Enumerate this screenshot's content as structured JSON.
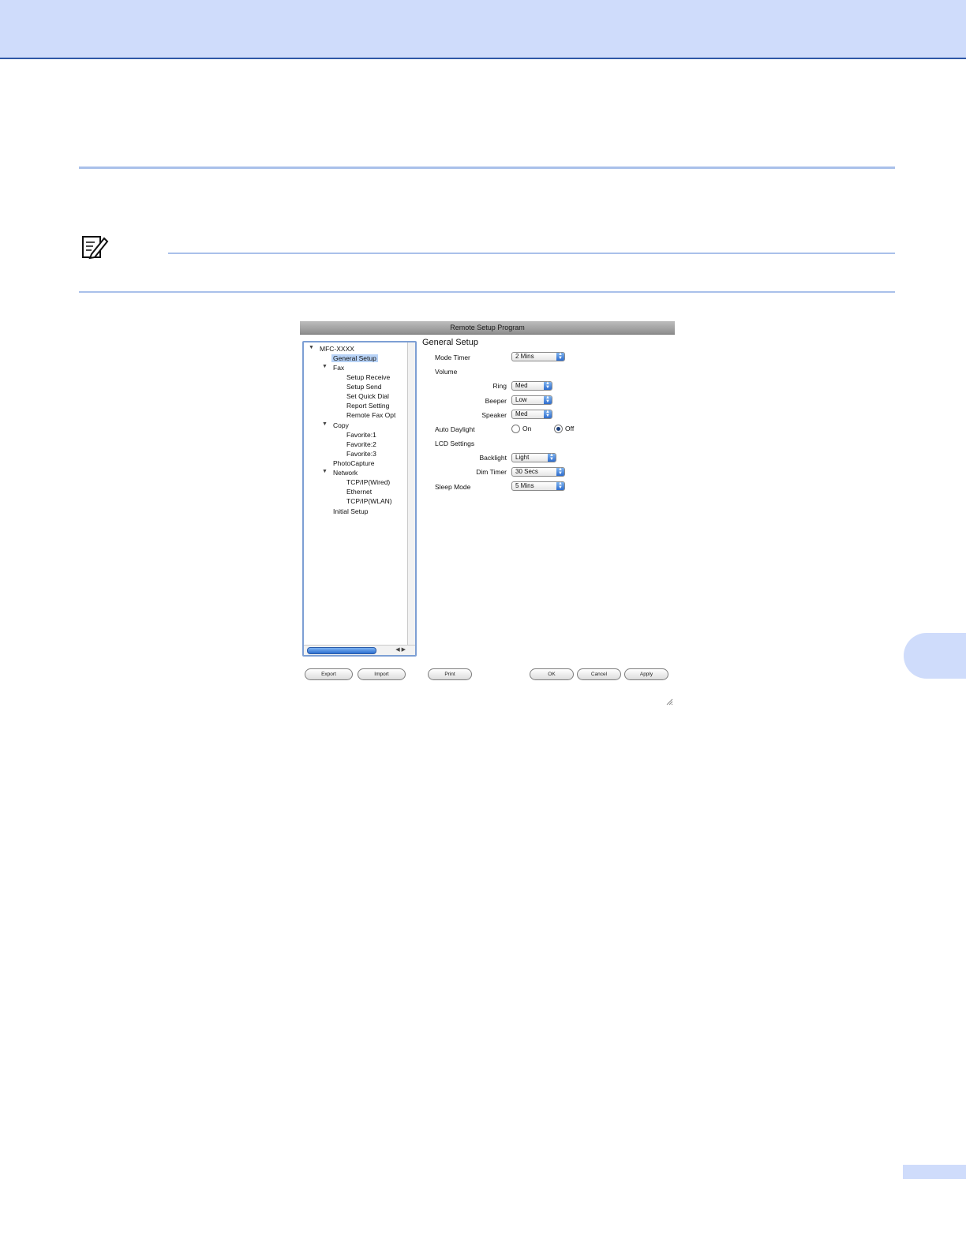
{
  "window": {
    "title": "Remote Setup Program"
  },
  "tree": {
    "root": "MFC-XXXX",
    "general_setup": "General Setup",
    "fax": "Fax",
    "fax_items": [
      "Setup Receive",
      "Setup Send",
      "Set Quick Dial",
      "Report Setting",
      "Remote Fax Opt"
    ],
    "copy": "Copy",
    "copy_items": [
      "Favorite:1",
      "Favorite:2",
      "Favorite:3"
    ],
    "photocapture": "PhotoCapture",
    "network": "Network",
    "network_items": [
      "TCP/IP(Wired)",
      "Ethernet",
      "TCP/IP(WLAN)"
    ],
    "initial_setup": "Initial Setup"
  },
  "panel": {
    "title": "General Setup",
    "mode_timer": {
      "label": "Mode Timer",
      "value": "2 Mins"
    },
    "volume": "Volume",
    "ring": {
      "label": "Ring",
      "value": "Med"
    },
    "beeper": {
      "label": "Beeper",
      "value": "Low"
    },
    "speaker": {
      "label": "Speaker",
      "value": "Med"
    },
    "auto_daylight": {
      "label": "Auto Daylight",
      "on": "On",
      "off": "Off",
      "selected": "Off"
    },
    "lcd_settings": "LCD Settings",
    "backlight": {
      "label": "Backlight",
      "value": "Light"
    },
    "dim_timer": {
      "label": "Dim Timer",
      "value": "30 Secs"
    },
    "sleep_mode": {
      "label": "Sleep Mode",
      "value": "5 Mins"
    }
  },
  "buttons": {
    "export": "Export",
    "import": "Import",
    "print": "Print",
    "ok": "OK",
    "cancel": "Cancel",
    "apply": "Apply"
  }
}
